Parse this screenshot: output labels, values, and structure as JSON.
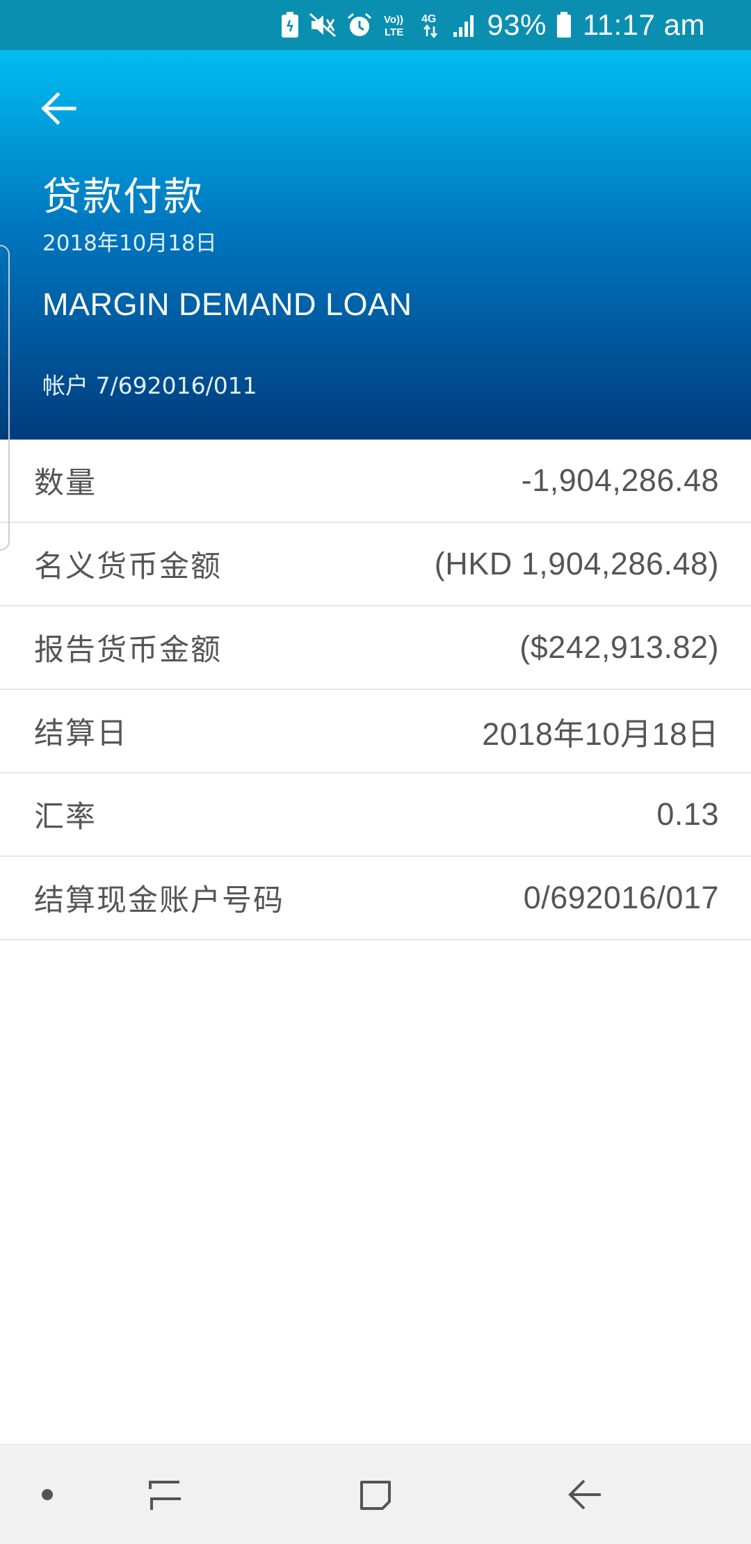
{
  "status_bar": {
    "icons": [
      "battery-saver-icon",
      "vibrate-mute-icon",
      "alarm-icon",
      "volte-icon",
      "4g-data-icon",
      "signal-icon",
      "battery-icon"
    ],
    "volte_text": "Vo)) LTE",
    "network_text": "4G",
    "battery_percent": "93%",
    "time": "11:17 am",
    "background_color": "#0b8fb1"
  },
  "header": {
    "back_icon": "arrow-left-icon",
    "title": "贷款付款",
    "date": "2018年10月18日",
    "description": "MARGIN DEMAND LOAN",
    "account": "帐户 7/692016/011",
    "gradient_top_color": "#00bdf2",
    "gradient_bottom_color": "#003c7d"
  },
  "details": [
    {
      "label": "数量",
      "value": "-1,904,286.48"
    },
    {
      "label": "名义货币金额",
      "value": "(HKD 1,904,286.48)"
    },
    {
      "label": "报告货币金额",
      "value": "($242,913.82)"
    },
    {
      "label": "结算日",
      "value": "2018年10月18日"
    },
    {
      "label": "汇率",
      "value": "0.13"
    },
    {
      "label": "结算现金账户号码",
      "value": "0/692016/017"
    }
  ],
  "nav_bar": {
    "items": [
      "dot-icon",
      "recent-apps-icon",
      "home-icon",
      "back-icon"
    ]
  }
}
